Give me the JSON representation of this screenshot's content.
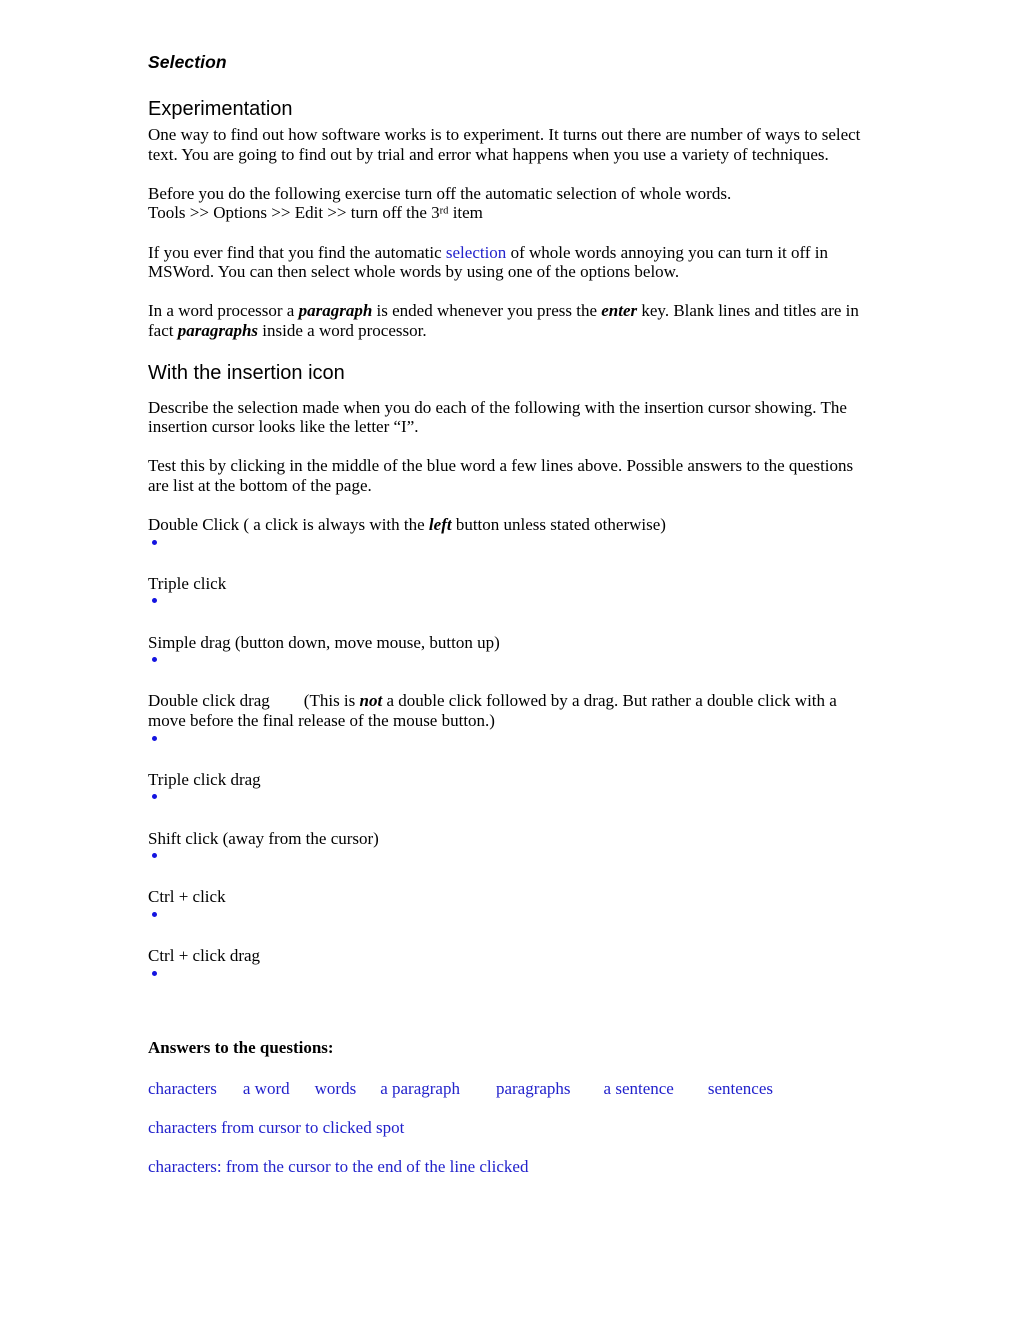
{
  "document": {
    "title": "Selection",
    "sections": {
      "experimentation": {
        "heading": "Experimentation",
        "para1": "One way to find out how software works is to experiment. It turns out there are number of ways to select text. You are going to find out by trial and error what happens when you use a variety of techniques.",
        "para2_line1": "Before you do the following exercise turn off the automatic selection of whole words.",
        "para2_line2_pre": "Tools >> Options >> Edit >> turn off the 3",
        "para2_line2_sup": "rd",
        "para2_line2_post": " item",
        "para3_pre": "If you ever find that you find the automatic ",
        "para3_link": "selection",
        "para3_post": " of whole words annoying you can turn it off in MSWord. You can then select whole words by using one of the options below.",
        "para4_a": "In a word processor a ",
        "para4_b": "paragraph",
        "para4_c": " is ended whenever you press the ",
        "para4_d": "enter",
        "para4_e": " key. Blank lines and titles are in fact ",
        "para4_f": "paragraphs",
        "para4_g": " inside a word processor."
      },
      "insertion": {
        "heading": "With the insertion icon",
        "para1": "Describe the selection made when you do each of the following with the insertion cursor showing. The insertion cursor looks like the letter “I”.",
        "para2": "Test this by clicking in the middle of the blue word a few lines above. Possible answers to the questions are list at the bottom of the page."
      }
    },
    "questions": [
      {
        "label_a": "Double Click (  a click is always with the ",
        "label_em": "left",
        "label_b": " button unless stated otherwise)",
        "bullet_answer": ""
      },
      {
        "label_a": "Triple click",
        "label_em": "",
        "label_b": "",
        "bullet_answer": ""
      },
      {
        "label_a": "Simple drag (button down, move mouse, button up)",
        "label_em": "",
        "label_b": "",
        "bullet_answer": ""
      },
      {
        "label_a": "Double click drag",
        "label_tab": true,
        "label_mid": "(This is ",
        "label_em": "not",
        "label_b": " a double click followed by a drag. But rather a double click with a move before the final release of the mouse button.)",
        "bullet_answer": ""
      },
      {
        "label_a": "Triple click drag",
        "label_em": "",
        "label_b": "",
        "bullet_answer": ""
      },
      {
        "label_a": "Shift click  (away from the cursor)",
        "label_em": "",
        "label_b": "",
        "bullet_answer": ""
      },
      {
        "label_a": "Ctrl + click",
        "label_em": "",
        "label_b": "",
        "bullet_answer": ""
      },
      {
        "label_a": "Ctrl + click drag",
        "label_em": "",
        "label_b": "",
        "bullet_answer": ""
      }
    ],
    "answers": {
      "heading": "Answers to the questions:",
      "row_words": [
        "characters",
        "a word",
        "words",
        "a paragraph",
        "paragraphs",
        "a sentence",
        "sentences"
      ],
      "line2": "characters from cursor to clicked spot",
      "line3": "characters: from the cursor to the end of the line clicked"
    }
  },
  "colors": {
    "link_blue": "#2222cc",
    "bullet_blue": "#1414e0",
    "text_black": "#000000",
    "page_background": "#ffffff"
  }
}
